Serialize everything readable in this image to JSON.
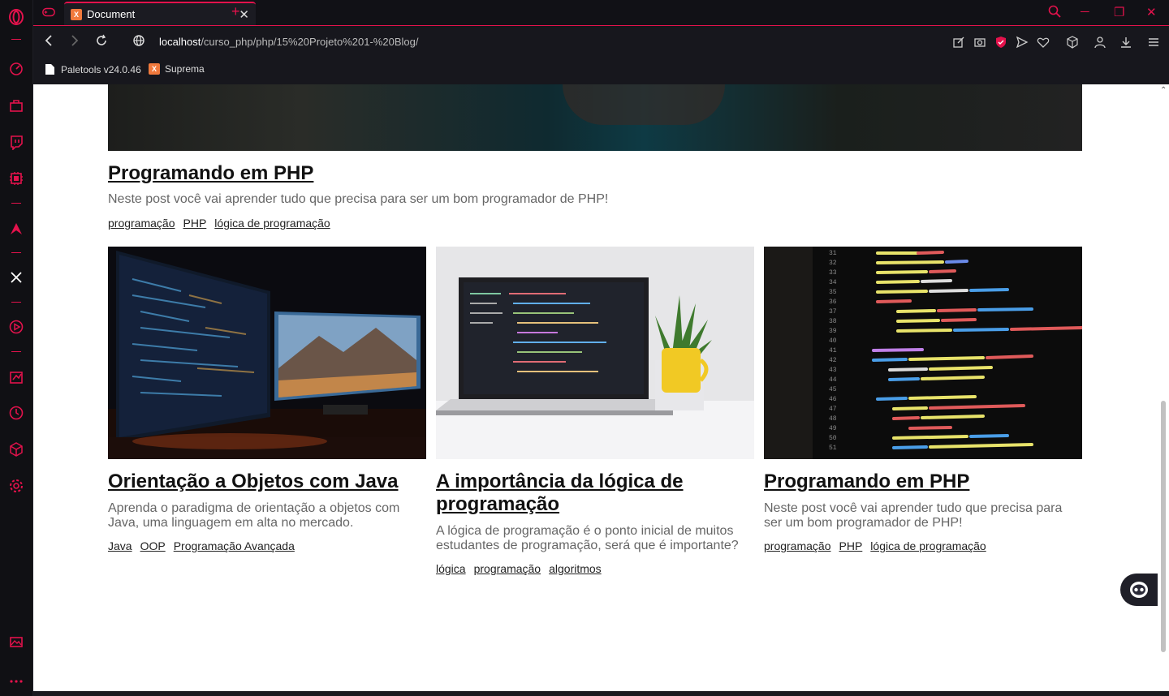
{
  "browser": {
    "tab_title": "Document",
    "url_host": "localhost",
    "url_path": "/curso_php/php/15%20Projeto%201-%20Blog/",
    "bookmarks": [
      {
        "label": "Paletools v24.0.46"
      },
      {
        "label": "Suprema"
      }
    ]
  },
  "featured": {
    "title": "Programando em PHP",
    "description": "Neste post você vai aprender tudo que precisa para ser um bom programador de PHP!",
    "tags": [
      "programação",
      "PHP",
      "lógica de programação"
    ]
  },
  "posts": [
    {
      "title": "Orientação a Objetos com Java",
      "description": "Aprenda o paradigma de orientação a objetos com Java, uma linguagem em alta no mercado.",
      "tags": [
        "Java",
        "OOP",
        "Programação Avançada"
      ]
    },
    {
      "title": "A importância da lógica de programação",
      "description": "A lógica de programação é o ponto inicial de muitos estudantes de programação, será que é importante?",
      "tags": [
        "lógica",
        "programação",
        "algoritmos"
      ]
    },
    {
      "title": "Programando em PHP",
      "description": "Neste post você vai aprender tudo que precisa para ser um bom programador de PHP!",
      "tags": [
        "programação",
        "PHP",
        "lógica de programação"
      ]
    }
  ],
  "colors": {
    "accent": "#e3124c",
    "chrome_bg": "#17171d"
  }
}
